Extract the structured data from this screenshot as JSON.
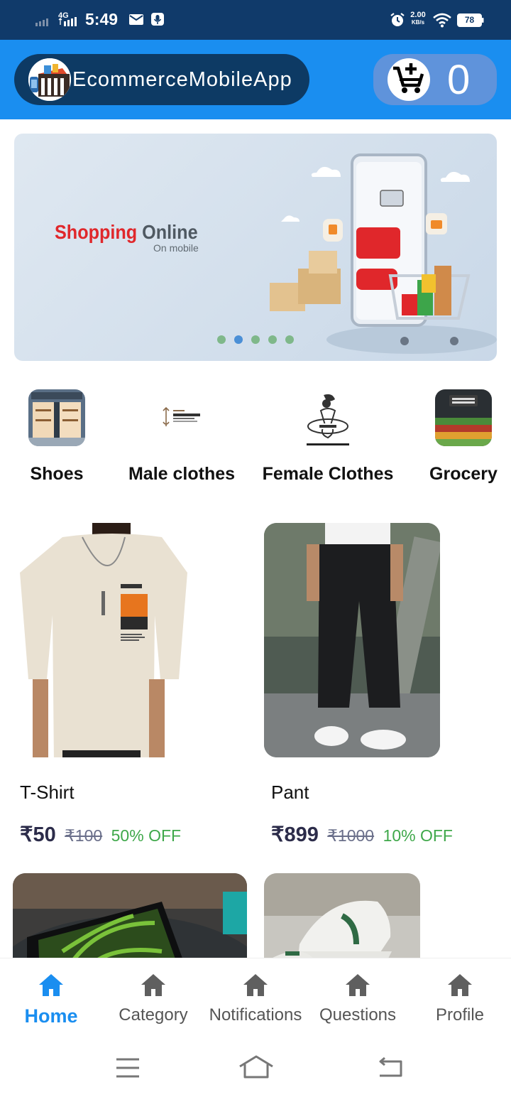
{
  "status_bar": {
    "network": "4G",
    "time": "5:49",
    "speed_value": "2.00",
    "speed_unit": "KB/s",
    "battery": "78",
    "icons": [
      "signal-icon",
      "mail-icon",
      "mic-icon",
      "alarm-icon",
      "wifi-icon",
      "battery-icon"
    ]
  },
  "app_bar": {
    "title": "EcommerceMobileApp",
    "cart_count": "0",
    "colors": {
      "bar": "#1a8ef0",
      "title_pill": "#0d3a64",
      "cart_pill": "#5f93db"
    }
  },
  "banner": {
    "headline_red": "Shopping",
    "headline_dark": "Online",
    "subtitle": "On mobile",
    "dot_count": 5,
    "active_dot": 1
  },
  "categories": [
    {
      "label": "Shoes",
      "icon": "storefront-thumb"
    },
    {
      "label": "Male clothes",
      "icon": "fashion-store-logo-thumb"
    },
    {
      "label": "Female Clothes",
      "icon": "fashion-store-logo-thumb"
    },
    {
      "label": "Grocery",
      "icon": "grocery-store-thumb"
    }
  ],
  "products": [
    {
      "name": "T-Shirt",
      "price": "₹50",
      "mrp": "₹100",
      "off": "50% OFF"
    },
    {
      "name": "Pant",
      "price": "₹899",
      "mrp": "₹1000",
      "off": "10% OFF"
    }
  ],
  "bottom_nav": {
    "items": [
      {
        "label": "Home",
        "icon": "home-icon",
        "active": true
      },
      {
        "label": "Category",
        "icon": "home-icon",
        "active": false
      },
      {
        "label": "Notifications",
        "icon": "home-icon",
        "active": false
      },
      {
        "label": "Questions",
        "icon": "home-icon",
        "active": false
      },
      {
        "label": "Profile",
        "icon": "home-icon",
        "active": false
      }
    ],
    "active_color": "#1a8ef0",
    "inactive_color": "#5f5f5f"
  },
  "system_nav": {
    "icons": [
      "menu-icon",
      "home-outline-icon",
      "back-icon"
    ]
  }
}
